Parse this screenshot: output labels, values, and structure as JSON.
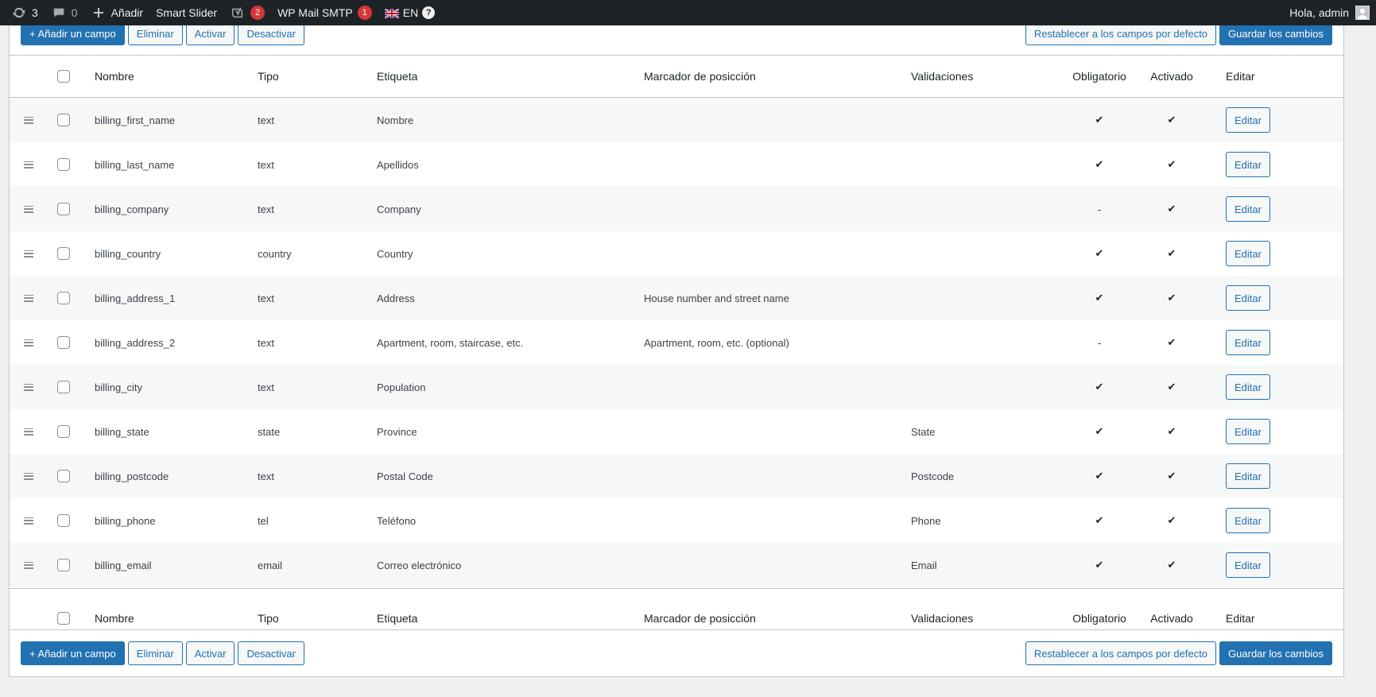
{
  "adminbar": {
    "updates_count": "3",
    "comments_count": "0",
    "new_label": "Añadir",
    "smart_slider_label": "Smart Slider",
    "yoast_badge": "2",
    "wp_mail_label": "WP Mail SMTP",
    "wp_mail_badge": "1",
    "language_label": "EN",
    "greeting": "Hola, admin"
  },
  "toolbar": {
    "add_field": "+ Añadir un campo",
    "delete": "Eliminar",
    "activate": "Activar",
    "deactivate": "Desactivar",
    "reset": "Restablecer a los campos por defecto",
    "save": "Guardar los cambios"
  },
  "table": {
    "columns": {
      "name": "Nombre",
      "type": "Tipo",
      "label": "Etiqueta",
      "placeholder": "Marcador de posicción",
      "validations": "Validaciones",
      "required": "Obligatorio",
      "enabled": "Activado",
      "edit": "Editar"
    },
    "edit_label": "Editar",
    "rows": [
      {
        "name": "billing_first_name",
        "type": "text",
        "label": "Nombre",
        "placeholder": "",
        "validation": "",
        "required": "✔",
        "enabled": "✔"
      },
      {
        "name": "billing_last_name",
        "type": "text",
        "label": "Apellidos",
        "placeholder": "",
        "validation": "",
        "required": "✔",
        "enabled": "✔"
      },
      {
        "name": "billing_company",
        "type": "text",
        "label": "Company",
        "placeholder": "",
        "validation": "",
        "required": "-",
        "enabled": "✔"
      },
      {
        "name": "billing_country",
        "type": "country",
        "label": "Country",
        "placeholder": "",
        "validation": "",
        "required": "✔",
        "enabled": "✔"
      },
      {
        "name": "billing_address_1",
        "type": "text",
        "label": "Address",
        "placeholder": "House number and street name",
        "validation": "",
        "required": "✔",
        "enabled": "✔"
      },
      {
        "name": "billing_address_2",
        "type": "text",
        "label": "Apartment, room, staircase, etc.",
        "placeholder": "Apartment, room, etc. (optional)",
        "validation": "",
        "required": "-",
        "enabled": "✔"
      },
      {
        "name": "billing_city",
        "type": "text",
        "label": "Population",
        "placeholder": "",
        "validation": "",
        "required": "✔",
        "enabled": "✔"
      },
      {
        "name": "billing_state",
        "type": "state",
        "label": "Province",
        "placeholder": "",
        "validation": "State",
        "required": "✔",
        "enabled": "✔"
      },
      {
        "name": "billing_postcode",
        "type": "text",
        "label": "Postal Code",
        "placeholder": "",
        "validation": "Postcode",
        "required": "✔",
        "enabled": "✔"
      },
      {
        "name": "billing_phone",
        "type": "tel",
        "label": "Teléfono",
        "placeholder": "",
        "validation": "Phone",
        "required": "✔",
        "enabled": "✔"
      },
      {
        "name": "billing_email",
        "type": "email",
        "label": "Correo electrónico",
        "placeholder": "",
        "validation": "Email",
        "required": "✔",
        "enabled": "✔"
      }
    ]
  }
}
